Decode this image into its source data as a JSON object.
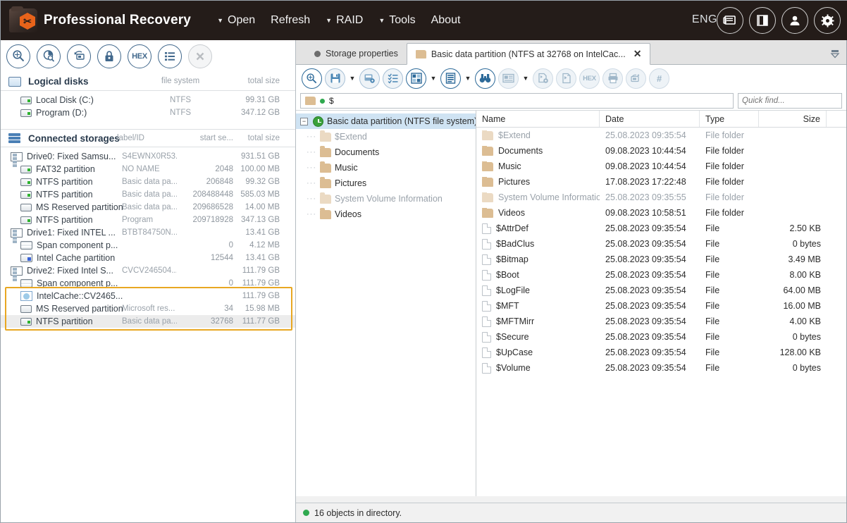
{
  "titlebar": {
    "app_title": "Professional Recovery",
    "logo_icon": "recovery-folder-logo",
    "menu": [
      {
        "label": "Open",
        "has_caret": true
      },
      {
        "label": "Refresh",
        "has_caret": false
      },
      {
        "label": "RAID",
        "has_caret": true
      },
      {
        "label": "Tools",
        "has_caret": true
      },
      {
        "label": "About",
        "has_caret": false
      }
    ],
    "language": "ENG",
    "buttons": [
      {
        "name": "windows-icon"
      },
      {
        "name": "panel-layout-icon"
      },
      {
        "name": "user-account-icon"
      },
      {
        "name": "settings-gear-icon"
      }
    ]
  },
  "left_panel": {
    "toolbar": [
      {
        "name": "find-magnifier-icon",
        "disabled": false
      },
      {
        "name": "disk-analysis-icon",
        "disabled": false
      },
      {
        "name": "disk-image-icon",
        "disabled": false
      },
      {
        "name": "lock-icon",
        "disabled": false
      },
      {
        "name": "hex-editor-icon",
        "label": "HEX",
        "disabled": false
      },
      {
        "name": "list-view-icon",
        "disabled": false
      },
      {
        "name": "close-icon",
        "disabled": true
      }
    ],
    "logical_disks": {
      "title": "Logical disks",
      "icon": "monitor-icon",
      "columns": {
        "file_system": "file system",
        "total_size": "total size"
      },
      "rows": [
        {
          "icon": "disk-icon",
          "name": "Local Disk (C:)",
          "label": "NTFS",
          "start": "",
          "size": "99.31 GB"
        },
        {
          "icon": "disk-icon",
          "name": "Program (D:)",
          "label": "NTFS",
          "start": "",
          "size": "347.12 GB"
        }
      ]
    },
    "connected_storages": {
      "title": "Connected storages",
      "icon": "storage-stack-icon",
      "columns": {
        "label_id": "label/ID",
        "start_sector": "start se...",
        "total_size": "total size"
      },
      "rows": [
        {
          "icon": "drive-icon",
          "kind": "drive",
          "name": "Drive0: Fixed Samsu...",
          "label": "S4EWNX0R53...",
          "start": "",
          "size": "931.51 GB"
        },
        {
          "icon": "partition-icon",
          "kind": "part",
          "name": "FAT32 partition",
          "label": "NO NAME",
          "start": "2048",
          "size": "100.00 MB"
        },
        {
          "icon": "partition-icon",
          "kind": "part",
          "name": "NTFS partition",
          "label": "Basic data pa...",
          "start": "206848",
          "size": "99.32 GB"
        },
        {
          "icon": "partition-icon",
          "kind": "part",
          "name": "NTFS partition",
          "label": "Basic data pa...",
          "start": "208488448",
          "size": "585.03 MB"
        },
        {
          "icon": "reserved-partition-icon",
          "kind": "res",
          "name": "MS Reserved partition",
          "label": "Basic data pa...",
          "start": "209686528",
          "size": "14.00 MB"
        },
        {
          "icon": "partition-icon",
          "kind": "part",
          "name": "NTFS partition",
          "label": "Program",
          "start": "209718928",
          "size": "347.13 GB"
        },
        {
          "icon": "drive-icon",
          "kind": "drive",
          "name": "Drive1: Fixed INTEL ...",
          "label": "BTBT84750N...",
          "start": "",
          "size": "13.41 GB"
        },
        {
          "icon": "span-component-icon",
          "kind": "span",
          "name": "Span component p...",
          "label": "",
          "start": "0",
          "size": "4.12 MB"
        },
        {
          "icon": "cache-partition-icon",
          "kind": "cache",
          "name": "Intel Cache partition",
          "label": "",
          "start": "12544",
          "size": "13.41 GB"
        },
        {
          "icon": "drive-icon",
          "kind": "drive",
          "name": "Drive2: Fixed Intel S...",
          "label": "CVCV246504...",
          "start": "",
          "size": "111.79 GB"
        },
        {
          "icon": "span-component-icon",
          "kind": "span",
          "name": "Span component p...",
          "label": "",
          "start": "0",
          "size": "111.79 GB"
        },
        {
          "icon": "intelcache-volume-icon",
          "kind": "ic",
          "name": "IntelCache::CV2465...",
          "label": "",
          "start": "",
          "size": "111.79 GB"
        },
        {
          "icon": "reserved-partition-icon",
          "kind": "res",
          "name": "MS Reserved partition",
          "label": "Microsoft res...",
          "start": "34",
          "size": "15.98 MB"
        },
        {
          "icon": "partition-icon",
          "kind": "part",
          "name": "NTFS partition",
          "label": "Basic data pa...",
          "start": "32768",
          "size": "111.77 GB",
          "selected": true
        }
      ],
      "highlight": {
        "from_index": 11,
        "to_index": 13,
        "color": "#e8a722"
      }
    }
  },
  "right_panel": {
    "tabs": [
      {
        "label": "Storage properties",
        "icon": "dot-icon",
        "active": false,
        "closable": false
      },
      {
        "label": "Basic data partition (NTFS at 32768 on IntelCac...",
        "icon": "folder-icon",
        "active": true,
        "closable": true,
        "close_label": "✕"
      }
    ],
    "tab_dropdown_icon": "chevron-down-icon",
    "toolbar": [
      {
        "name": "find-magnifier-icon",
        "style": "strong"
      },
      {
        "name": "save-disk-icon",
        "style": "normal",
        "caret": true
      },
      {
        "name": "save-settings-icon",
        "style": "normal"
      },
      {
        "name": "checklist-icon",
        "style": "normal"
      },
      {
        "name": "grid-layout-icon",
        "style": "strong",
        "caret": true
      },
      {
        "name": "list-detail-icon",
        "style": "strong",
        "caret": true
      },
      {
        "name": "binoculars-search-icon",
        "style": "strong"
      },
      {
        "name": "preview-pane-icon",
        "style": "pale",
        "caret": true
      },
      {
        "name": "copy-settings-icon",
        "style": "pale"
      },
      {
        "name": "copy-file-icon",
        "style": "pale"
      },
      {
        "name": "hex-view-icon",
        "label": "HEX",
        "style": "pale"
      },
      {
        "name": "print-icon",
        "style": "pale"
      },
      {
        "name": "export-icon",
        "style": "pale"
      },
      {
        "name": "number-icon",
        "label": "#",
        "style": "pale"
      }
    ],
    "path": {
      "folder_icon": "folder-icon",
      "status_dot": "green-dot",
      "value": "$"
    },
    "quick_find": {
      "placeholder": "Quick find...",
      "value": "",
      "search_icon": "search-icon"
    },
    "tree": {
      "root": {
        "label": "Basic data partition (NTFS file system)",
        "icon": "green-clock-icon",
        "expanded": true,
        "selected": true
      },
      "children": [
        {
          "label": "$Extend",
          "icon": "folder-icon",
          "dim": true
        },
        {
          "label": "Documents",
          "icon": "folder-icon",
          "dim": false
        },
        {
          "label": "Music",
          "icon": "folder-icon",
          "dim": false
        },
        {
          "label": "Pictures",
          "icon": "folder-icon",
          "dim": false
        },
        {
          "label": "System Volume Information",
          "icon": "folder-icon",
          "dim": true
        },
        {
          "label": "Videos",
          "icon": "folder-icon",
          "dim": false
        }
      ]
    },
    "file_list": {
      "columns": [
        "Name",
        "Date",
        "Type",
        "Size"
      ],
      "rows": [
        {
          "icon": "folder-icon",
          "name": "$Extend",
          "date": "25.08.2023 09:35:54",
          "type": "File folder",
          "size": "",
          "dim": true
        },
        {
          "icon": "folder-icon",
          "name": "Documents",
          "date": "09.08.2023 10:44:54",
          "type": "File folder",
          "size": "",
          "dim": false
        },
        {
          "icon": "folder-icon",
          "name": "Music",
          "date": "09.08.2023 10:44:54",
          "type": "File folder",
          "size": "",
          "dim": false
        },
        {
          "icon": "folder-icon",
          "name": "Pictures",
          "date": "17.08.2023 17:22:48",
          "type": "File folder",
          "size": "",
          "dim": false
        },
        {
          "icon": "folder-icon",
          "name": "System Volume Information",
          "date": "25.08.2023 09:35:55",
          "type": "File folder",
          "size": "",
          "dim": true
        },
        {
          "icon": "folder-icon",
          "name": "Videos",
          "date": "09.08.2023 10:58:51",
          "type": "File folder",
          "size": "",
          "dim": false
        },
        {
          "icon": "file-icon",
          "name": "$AttrDef",
          "date": "25.08.2023 09:35:54",
          "type": "File",
          "size": "2.50 KB",
          "dim": false
        },
        {
          "icon": "file-icon",
          "name": "$BadClus",
          "date": "25.08.2023 09:35:54",
          "type": "File",
          "size": "0 bytes",
          "dim": false
        },
        {
          "icon": "file-icon",
          "name": "$Bitmap",
          "date": "25.08.2023 09:35:54",
          "type": "File",
          "size": "3.49 MB",
          "dim": false
        },
        {
          "icon": "file-icon",
          "name": "$Boot",
          "date": "25.08.2023 09:35:54",
          "type": "File",
          "size": "8.00 KB",
          "dim": false
        },
        {
          "icon": "file-icon",
          "name": "$LogFile",
          "date": "25.08.2023 09:35:54",
          "type": "File",
          "size": "64.00 MB",
          "dim": false
        },
        {
          "icon": "file-icon",
          "name": "$MFT",
          "date": "25.08.2023 09:35:54",
          "type": "File",
          "size": "16.00 MB",
          "dim": false
        },
        {
          "icon": "file-icon",
          "name": "$MFTMirr",
          "date": "25.08.2023 09:35:54",
          "type": "File",
          "size": "4.00 KB",
          "dim": false
        },
        {
          "icon": "file-icon",
          "name": "$Secure",
          "date": "25.08.2023 09:35:54",
          "type": "File",
          "size": "0 bytes",
          "dim": false
        },
        {
          "icon": "file-icon",
          "name": "$UpCase",
          "date": "25.08.2023 09:35:54",
          "type": "File",
          "size": "128.00 KB",
          "dim": false
        },
        {
          "icon": "file-icon",
          "name": "$Volume",
          "date": "25.08.2023 09:35:54",
          "type": "File",
          "size": "0 bytes",
          "dim": false
        }
      ]
    },
    "status": {
      "dot": "green-dot",
      "text": "16 objects in directory."
    }
  },
  "colors": {
    "titlebar_bg": "#241c19",
    "accent_orange": "#e8631a",
    "highlight_border": "#e8a722",
    "tree_selection": "#cfe3f3",
    "row_selection": "#ececec",
    "icon_blue": "#41688c"
  }
}
